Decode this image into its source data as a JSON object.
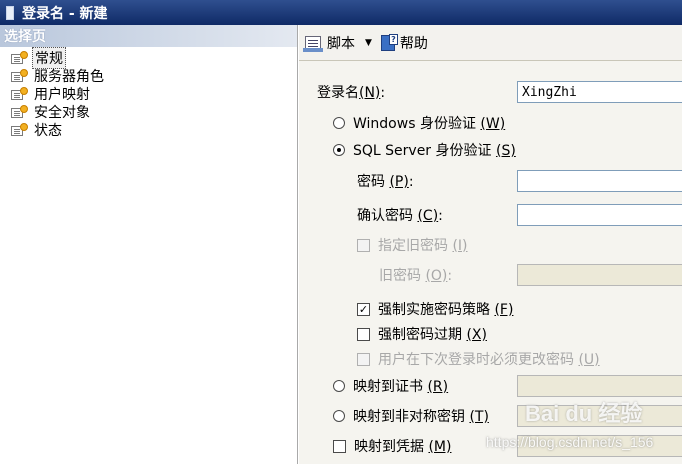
{
  "window": {
    "title": "登录名 - 新建"
  },
  "left_panel": {
    "header": "选择页",
    "items": [
      {
        "label": "常规",
        "selected": true
      },
      {
        "label": "服务器角色",
        "selected": false
      },
      {
        "label": "用户映射",
        "selected": false
      },
      {
        "label": "安全对象",
        "selected": false
      },
      {
        "label": "状态",
        "selected": false
      }
    ]
  },
  "toolbar": {
    "script_label": "脚本",
    "help_label": "帮助"
  },
  "form": {
    "login_name": {
      "label": "登录名",
      "mnemonic": "(N)",
      "suffix": ":",
      "value": "XingZhi"
    },
    "windows_auth": {
      "label": "Windows 身份验证",
      "mnemonic": "(W)",
      "checked": false
    },
    "sql_auth": {
      "label": "SQL Server 身份验证",
      "mnemonic": "(S)",
      "checked": true
    },
    "password": {
      "label": "密码",
      "mnemonic": "(P)",
      "suffix": ":",
      "value": ""
    },
    "confirm_password": {
      "label": "确认密码",
      "mnemonic": "(C)",
      "suffix": ":",
      "value": ""
    },
    "specify_old_password": {
      "label": "指定旧密码",
      "mnemonic": "(I)",
      "checked": false
    },
    "old_password": {
      "label": "旧密码",
      "mnemonic": "(O)",
      "suffix": ":",
      "value": ""
    },
    "enforce_policy": {
      "label": "强制实施密码策略",
      "mnemonic": "(F)",
      "checked": true,
      "mark": "✓"
    },
    "enforce_expiration": {
      "label": "强制密码过期",
      "mnemonic": "(X)",
      "checked": false
    },
    "must_change": {
      "label": "用户在下次登录时必须更改密码",
      "mnemonic": "(U)",
      "checked": false
    },
    "map_certificate": {
      "label": "映射到证书",
      "mnemonic": "(R)",
      "checked": false
    },
    "map_asymmetric_key": {
      "label": "映射到非对称密钥",
      "mnemonic": "(T)",
      "checked": false
    },
    "map_credential": {
      "label": "映射到凭据",
      "mnemonic": "(M)",
      "checked": false
    }
  },
  "watermark": {
    "logo": "Bai du 经验",
    "url": "https://blog.csdn.net/s_156"
  },
  "colors": {
    "title_bar": "#0f2a66",
    "panel_bg": "#f5f4ef",
    "field_border": "#7f9db9"
  }
}
